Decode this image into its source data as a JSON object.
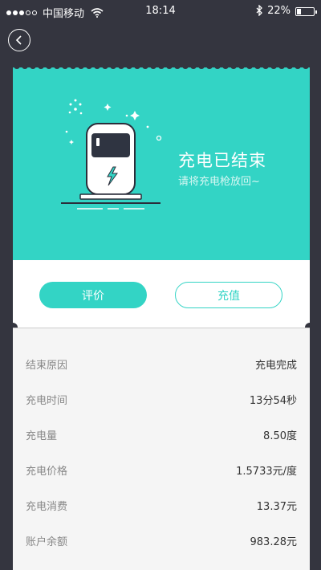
{
  "status_bar": {
    "carrier": "中国移动",
    "time": "18:14",
    "battery": "22%"
  },
  "result": {
    "title": "充电已结束",
    "subtitle": "请将充电枪放回~"
  },
  "buttons": {
    "rate": "评价",
    "recharge": "充值"
  },
  "details": [
    {
      "label": "结束原因",
      "value": "充电完成"
    },
    {
      "label": "充电时间",
      "value": "13分54秒"
    },
    {
      "label": "充电量",
      "value": "8.50度"
    },
    {
      "label": "充电价格",
      "value": "1.5733元/度"
    },
    {
      "label": "充电消费",
      "value": "13.37元"
    },
    {
      "label": "账户余额",
      "value": "983.28元"
    }
  ],
  "colors": {
    "accent": "#33d4c5",
    "background": "#34353f"
  },
  "icons": {
    "back": "chevron-left-icon",
    "charger": "charger-station-icon",
    "bolt": "lightning-bolt-icon"
  }
}
